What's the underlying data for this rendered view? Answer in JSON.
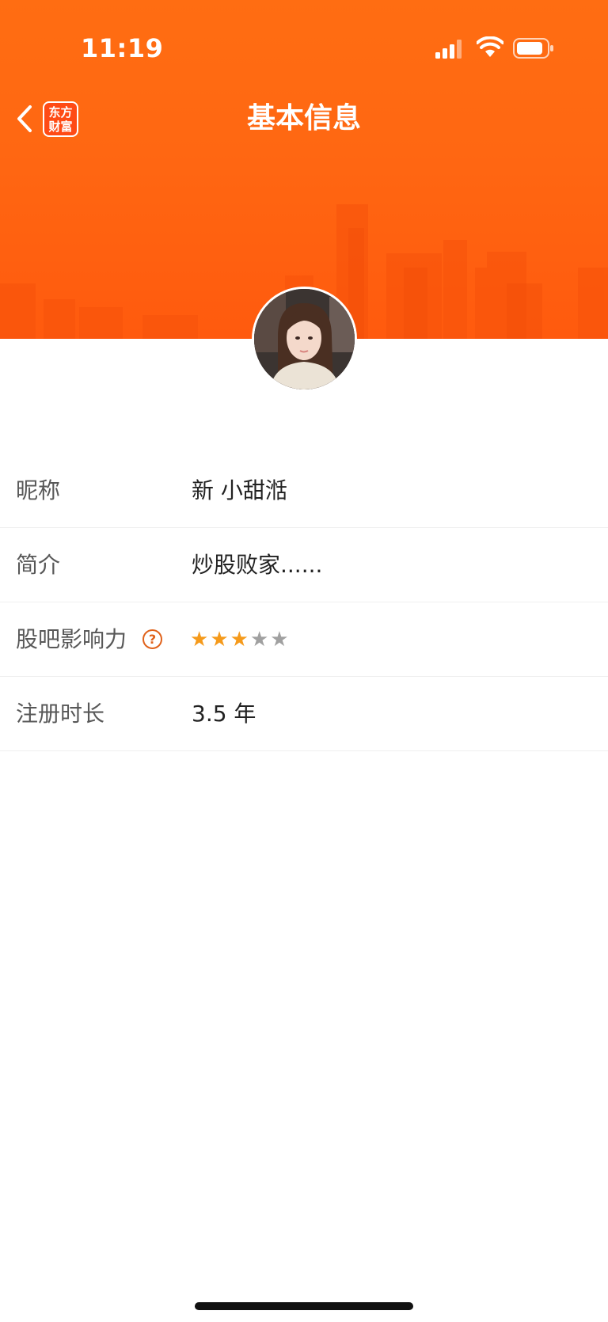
{
  "status_bar": {
    "time": "11:19",
    "icons": [
      "signal-icon",
      "wifi-icon",
      "battery-icon"
    ]
  },
  "nav": {
    "back_icon": "chevron-left-icon",
    "logo_line1": "东方",
    "logo_line2": "财富",
    "title": "基本信息"
  },
  "profile": {
    "avatar": "user-avatar"
  },
  "rows": [
    {
      "label": "昵称",
      "value": "新 小甜湉"
    },
    {
      "label": "简介",
      "value": "炒股败家......"
    },
    {
      "label": "股吧影响力",
      "help_icon": "question-icon",
      "rating": 3,
      "rating_max": 5
    },
    {
      "label": "注册时长",
      "value": "3.5 年"
    }
  ],
  "colors": {
    "brand_orange": "#ff6712",
    "star_on": "#f59a1b",
    "star_off": "#a0a0a0"
  }
}
